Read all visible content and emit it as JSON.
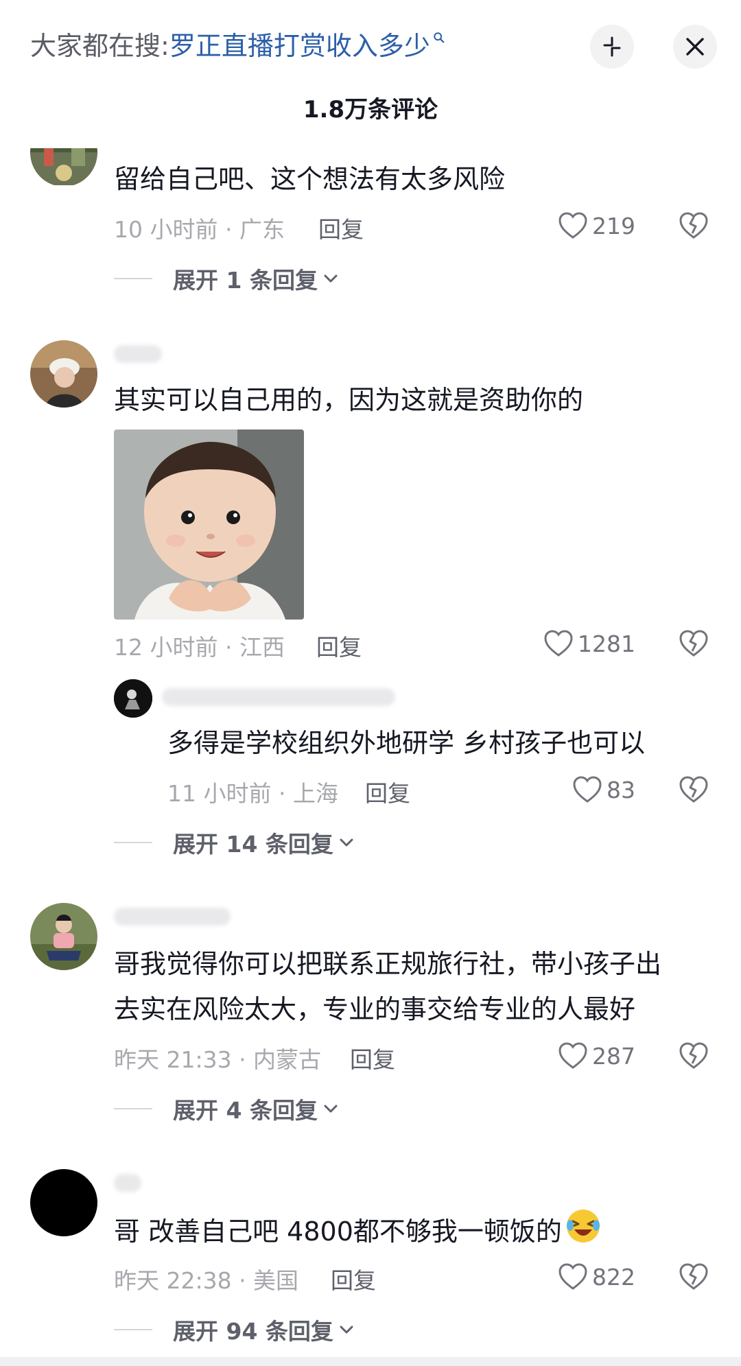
{
  "header": {
    "search_prefix": "大家都在搜:",
    "search_term": "罗正直播打赏收入多少",
    "comment_count": "1.8万条评论"
  },
  "icons": {
    "search": "search-icon",
    "collapse": "collapse-icon",
    "close": "close-icon",
    "like": "heart-icon",
    "dislike": "broken-heart-icon",
    "chevron": "chevron-down-icon"
  },
  "comments": [
    {
      "text": "留给自己吧、这个想法有太多风险",
      "meta": "10 小时前 · 广东",
      "reply": "回复",
      "likes": "219",
      "expand": "展开 1 条回复"
    },
    {
      "text": "其实可以自己用的，因为这就是资助你的",
      "meta": "12 小时前 · 江西",
      "reply": "回复",
      "likes": "1281",
      "expand": "展开 14 条回复",
      "sub_reply": {
        "text": "多得是学校组织外地研学 乡村孩子也可以",
        "meta": "11 小时前 · 上海",
        "reply": "回复",
        "likes": "83"
      }
    },
    {
      "text_line1": "哥我觉得你可以把联系正规旅行社，带小孩子出",
      "text_line2": "去实在风险太大，专业的事交给专业的人最好",
      "meta": "昨天 21:33 · 内蒙古",
      "reply": "回复",
      "likes": "287",
      "expand": "展开 4 条回复"
    },
    {
      "text": "哥 改善自己吧 4800都不够我一顿饭的",
      "meta": "昨天 22:38 · 美国",
      "reply": "回复",
      "likes": "822",
      "expand": "展开 94 条回复"
    }
  ],
  "colors": {
    "search_term": "#2c5fa8",
    "meta": "#a7a8ad",
    "text": "#161823"
  }
}
